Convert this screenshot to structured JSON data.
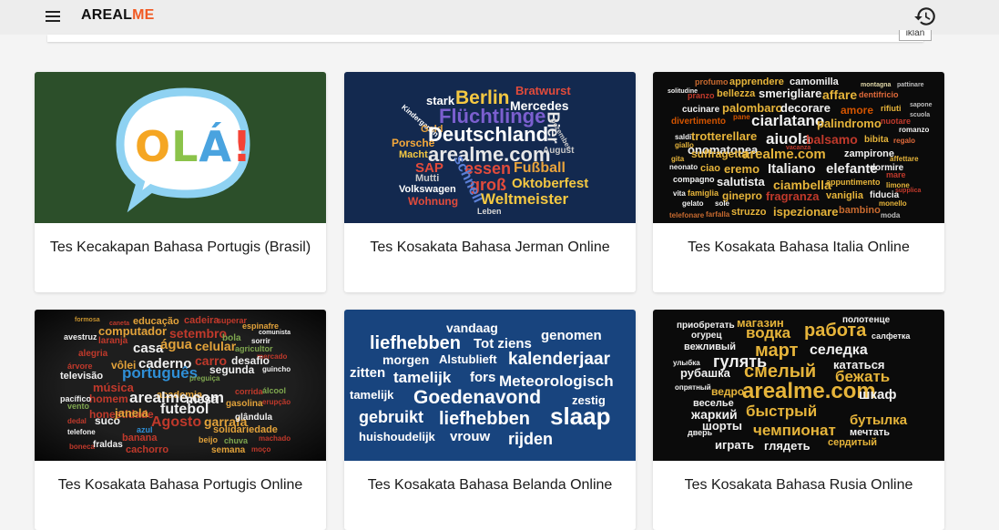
{
  "header": {
    "logo_part1": "AREAL",
    "logo_part2": "ME",
    "search_button": "iklan",
    "menu_icon": "hamburger-menu-icon",
    "history_icon": "history-icon"
  },
  "cards": [
    {
      "title": "Tes Kecakapan Bahasa Portugis (Brasil)",
      "bubble_text": "OLÁ!"
    },
    {
      "title": "Tes Kosakata Bahasa Jerman Online"
    },
    {
      "title": "Tes Kosakata Bahasa Italia Online"
    },
    {
      "title": "Tes Kosakata Bahasa Portugis Online"
    },
    {
      "title": "Tes Kosakata Bahasa Belanda Online"
    },
    {
      "title": "Tes Kosakata Bahasa Rusia Online"
    }
  ],
  "wordclouds": {
    "german": [
      "Berlin",
      "Bratwurst",
      "stark",
      "Flüchtlinge",
      "Mercedes",
      "Bier",
      "Kindergarten",
      "Geld",
      "Deutschland",
      "Dezember",
      "Porsche",
      "arealme.com",
      "August",
      "Macht",
      "essen",
      "Fußball",
      "SAP",
      "groß",
      "Oktoberfest",
      "schnell",
      "Volkswagen",
      "Weltmeister",
      "Wohnung",
      "Leben",
      "Mutti"
    ],
    "italian": [
      "profumo",
      "apprendere",
      "camomilla",
      "montagna",
      "pattinare",
      "solitudine",
      "pranzo",
      "bellezza",
      "smerigliare",
      "affare",
      "dentifricio",
      "cucinare",
      "palombaro",
      "decorare",
      "amore",
      "rifiuti",
      "sapone",
      "divertimento",
      "pane",
      "ciarlatano",
      "palindromo",
      "nuotare",
      "scuola",
      "saldi",
      "trotterellare",
      "romanzo",
      "giallo",
      "onomatopea",
      "aiuola",
      "balsamo",
      "bibita",
      "regalo",
      "suffragetta",
      "vacanza",
      "zampirone",
      "gita",
      "neonato",
      "arealme.com",
      "dormire",
      "ciao",
      "eremo",
      "Italiano",
      "elefante",
      "appuntimento",
      "compagno",
      "salutista",
      "ciambella",
      "mare",
      "vita",
      "famiglia",
      "ginepro",
      "fragranza",
      "vaniglia",
      "fiducia",
      "gelato",
      "sole",
      "monello",
      "telefonare",
      "farfalla",
      "struzzo",
      "ispezionare",
      "bambino",
      "moda",
      "affettare",
      "limone",
      "supplica"
    ],
    "portuguese": [
      "formosa",
      "educação",
      "cadeira",
      "superar",
      "caneta",
      "espinafre",
      "computador",
      "comunista",
      "avestruz",
      "laranja",
      "setembro",
      "bola",
      "sorrir",
      "alegria",
      "casa",
      "água",
      "celular",
      "agricultor",
      "árvore",
      "vôlei",
      "televisão",
      "caderno",
      "mercado",
      "desafio",
      "português",
      "carro",
      "segunda",
      "guincho",
      "preguiça",
      "música",
      "homem",
      "academia",
      "corrida",
      "álcool",
      "vento",
      "arealme.com",
      "mesa",
      "gasolina",
      "dedal",
      "honestidade",
      "suco",
      "futebol",
      "erupção",
      "telefone",
      "janela",
      "Agosto",
      "garrafa",
      "glândula",
      "azul",
      "banana",
      "solidariedade",
      "boneca",
      "fraldas",
      "cachorro",
      "chuva",
      "semana",
      "machado",
      "moço",
      "pacífico",
      "beijo"
    ],
    "dutch": [
      "vandaag",
      "liefhebben",
      "Tot ziens",
      "genomen",
      "morgen",
      "Alstublieft",
      "kalenderjaar",
      "zitten",
      "tamelijk",
      "fors",
      "Meteorologisch",
      "tamelijk",
      "Goedenavond",
      "zestig",
      "gebruikt",
      "liefhebben",
      "slaap",
      "huishoudelijk",
      "vrouw",
      "rijden"
    ],
    "russian": [
      "магазин",
      "полотенце",
      "приобретать",
      "огурец",
      "водка",
      "работа",
      "салфетка",
      "вежливый",
      "март",
      "селедка",
      "гулять",
      "улыбка",
      "рубашка",
      "кататься",
      "смелый",
      "бежать",
      "опрятный",
      "ведро",
      "arealme.com",
      "шкаф",
      "веселье",
      "жаркий",
      "быстрый",
      "бутылка",
      "шорты",
      "чемпионат",
      "дверь",
      "мечтать",
      "играть",
      "глядеть",
      "сердитый"
    ]
  },
  "colors": {
    "accent": "#f15a24",
    "header_bg": "#ededed",
    "page_bg": "#f4f4f4",
    "pt_brazil_bg": "#2c4f2a",
    "german_bg": "#13294f",
    "dutch_bg": "#18447e"
  }
}
